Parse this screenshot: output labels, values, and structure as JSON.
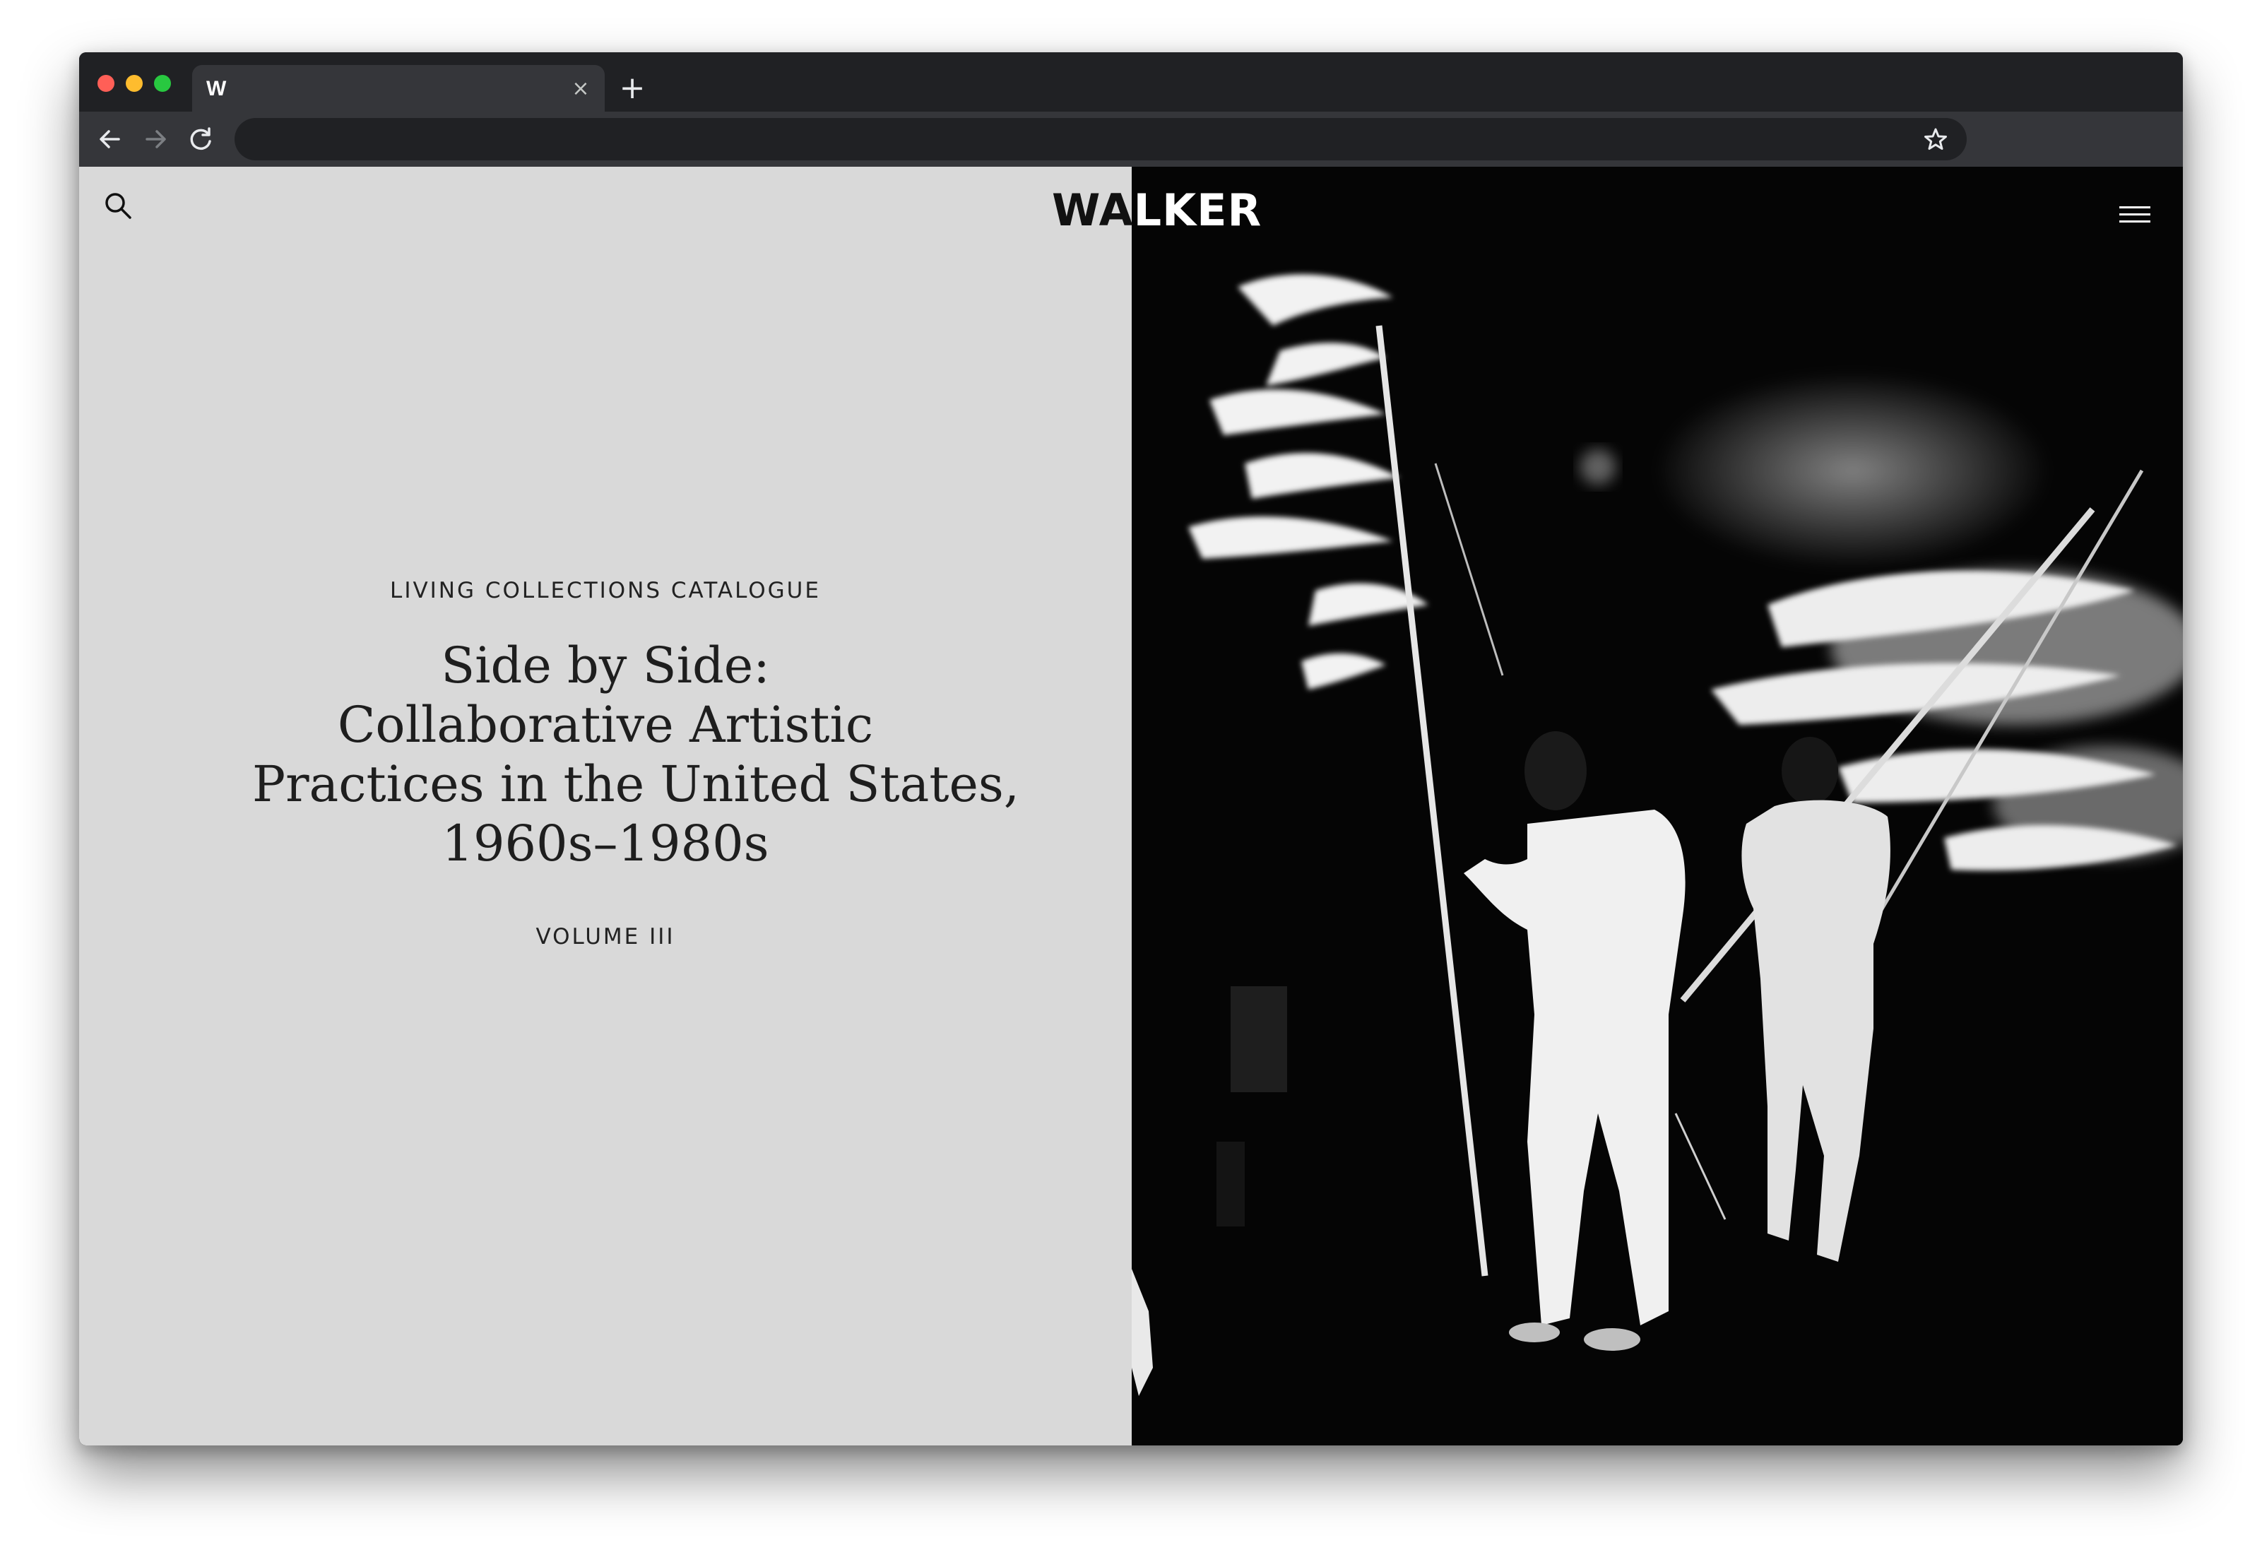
{
  "browser": {
    "tab": {
      "favicon_text": "W",
      "close_glyph": "×"
    },
    "new_tab_glyph": "+",
    "toolbar": {
      "back_icon": "arrow-left-icon",
      "forward_icon": "arrow-right-icon",
      "reload_icon": "reload-icon",
      "address_value": "",
      "bookmark_icon": "star-icon"
    }
  },
  "header": {
    "logo_left": "WA",
    "logo_right": "LKER",
    "search_icon": "search-icon",
    "menu_icon": "hamburger-icon"
  },
  "hero": {
    "eyebrow": "LIVING COLLECTIONS CATALOGUE",
    "title_lines": [
      "Side by Side:",
      "Collaborative Artistic",
      "Practices in the United States,",
      "1960s–1980s"
    ],
    "volume": "VOLUME III"
  },
  "colors": {
    "left_panel": "#d9d9d9",
    "right_panel": "#050505",
    "chrome_dark": "#202124",
    "chrome_toolbar": "#35363a"
  }
}
